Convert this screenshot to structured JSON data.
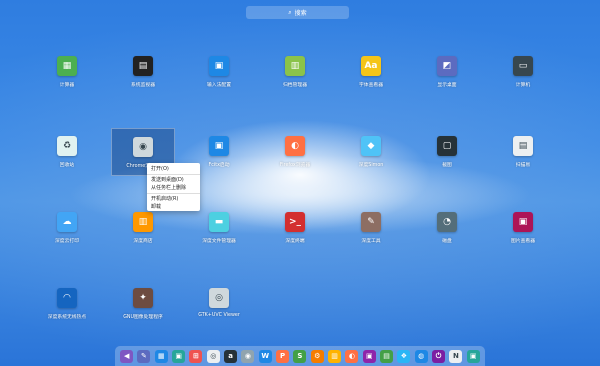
{
  "search": {
    "label": "搜索",
    "icon": "search-icon"
  },
  "apps": [
    {
      "label": "计算器",
      "icon": "calculator-icon",
      "color": "#4caf50",
      "glyph": "▦"
    },
    {
      "label": "系统监视器",
      "icon": "system-monitor-icon",
      "color": "#222222",
      "glyph": "▤"
    },
    {
      "label": "输入法配置",
      "icon": "input-method-icon",
      "color": "#1e88e5",
      "glyph": "▣"
    },
    {
      "label": "归档管理器",
      "icon": "archive-manager-icon",
      "color": "#8bc34a",
      "glyph": "▥"
    },
    {
      "label": "字体查看器",
      "icon": "font-viewer-icon",
      "color": "#f5c518",
      "glyph": "Aa"
    },
    {
      "label": "显示桌面",
      "icon": "show-desktop-icon",
      "color": "#5c6bc0",
      "glyph": "◩"
    },
    {
      "label": "计算机",
      "icon": "computer-icon",
      "color": "#37474f",
      "glyph": "▭"
    },
    {
      "label": "回收站",
      "icon": "trash-icon",
      "color": "#e0f2f1",
      "glyph": "♻"
    },
    {
      "label": "Chrome浏览器",
      "icon": "chrome-icon",
      "color": "#cfd8dc",
      "glyph": "◉"
    },
    {
      "label": "Fcitx启动",
      "icon": "fcitx-icon",
      "color": "#1e88e5",
      "glyph": "▣"
    },
    {
      "label": "Firefox浏览器",
      "icon": "firefox-icon",
      "color": "#ff7043",
      "glyph": "◐"
    },
    {
      "label": "深度Simon",
      "icon": "simon-icon",
      "color": "#4fc3f7",
      "glyph": "◆"
    },
    {
      "label": "截图",
      "icon": "screenshot-icon",
      "color": "#263238",
      "glyph": "▢"
    },
    {
      "label": "扫描易",
      "icon": "scanner-icon",
      "color": "#eceff1",
      "glyph": "▤"
    },
    {
      "label": "深度云打印",
      "icon": "cloud-print-icon",
      "color": "#42a5f5",
      "glyph": "☁"
    },
    {
      "label": "深度商店",
      "icon": "store-icon",
      "color": "#ff9800",
      "glyph": "▥"
    },
    {
      "label": "深度文件管理器",
      "icon": "file-manager-icon",
      "color": "#4dd0e1",
      "glyph": "▬"
    },
    {
      "label": "深度终端",
      "icon": "terminal-icon",
      "color": "#d32f2f",
      "glyph": ">_"
    },
    {
      "label": "深度工具",
      "icon": "paint-brush-icon",
      "color": "#8d6e63",
      "glyph": "✎"
    },
    {
      "label": "磁盘",
      "icon": "disk-icon",
      "color": "#546e7a",
      "glyph": "◔"
    },
    {
      "label": "图片查看器",
      "icon": "image-viewer-icon",
      "color": "#ad1457",
      "glyph": "▣"
    },
    {
      "label": "深度系统无线热点",
      "icon": "wifi-hotspot-icon",
      "color": "#1565c0",
      "glyph": "◠"
    },
    {
      "label": "GNU图像处理程序",
      "icon": "gimp-icon",
      "color": "#6d4c41",
      "glyph": "✦"
    },
    {
      "label": "GTK+UVC Viewer",
      "icon": "webcam-icon",
      "color": "#cfd8dc",
      "glyph": "◎"
    }
  ],
  "context_menu": {
    "items": [
      "打开(O)",
      "发送到桌面(D)",
      "从任务栏上删除",
      "开机启动(R)",
      "卸载"
    ]
  },
  "dock": [
    {
      "icon": "launcher-icon",
      "color": "#7e57c2",
      "glyph": "◀"
    },
    {
      "icon": "dock-app-2-icon",
      "color": "#5c6bc0",
      "glyph": "✎"
    },
    {
      "icon": "dock-app-3-icon",
      "color": "#1e88e5",
      "glyph": "▦"
    },
    {
      "icon": "dock-app-4-icon",
      "color": "#26a69a",
      "glyph": "▣"
    },
    {
      "icon": "dock-app-5-icon",
      "color": "#ef5350",
      "glyph": "⊞"
    },
    {
      "icon": "dock-app-6-icon",
      "color": "#eceff1",
      "glyph": "◎"
    },
    {
      "icon": "dock-app-7-icon",
      "color": "#263238",
      "glyph": "a"
    },
    {
      "icon": "dock-app-8-icon",
      "color": "#90a4ae",
      "glyph": "◉"
    },
    {
      "icon": "wps-writer-icon",
      "color": "#1e88e5",
      "glyph": "W"
    },
    {
      "icon": "wps-presentation-icon",
      "color": "#ff7043",
      "glyph": "P"
    },
    {
      "icon": "wps-spreadsheet-icon",
      "color": "#43a047",
      "glyph": "S"
    },
    {
      "icon": "settings-icon",
      "color": "#f57c00",
      "glyph": "⚙"
    },
    {
      "icon": "dock-app-13-icon",
      "color": "#ffb300",
      "glyph": "▥"
    },
    {
      "icon": "dock-app-14-icon",
      "color": "#ff7043",
      "glyph": "◐"
    },
    {
      "icon": "dock-app-15-icon",
      "color": "#8e24aa",
      "glyph": "▣"
    },
    {
      "icon": "dock-app-16-icon",
      "color": "#43a047",
      "glyph": "▤"
    },
    {
      "icon": "dock-app-17-icon",
      "color": "#29b6f6",
      "glyph": "❖"
    },
    {
      "icon": "dock-app-18-icon",
      "color": "#1e88e5",
      "glyph": "◍"
    },
    {
      "icon": "power-icon",
      "color": "#7b1fa2",
      "glyph": "⏻"
    },
    {
      "icon": "dock-app-20-icon",
      "color": "#eceff1",
      "glyph": "N"
    },
    {
      "icon": "dock-app-21-icon",
      "color": "#26a69a",
      "glyph": "▣"
    }
  ]
}
